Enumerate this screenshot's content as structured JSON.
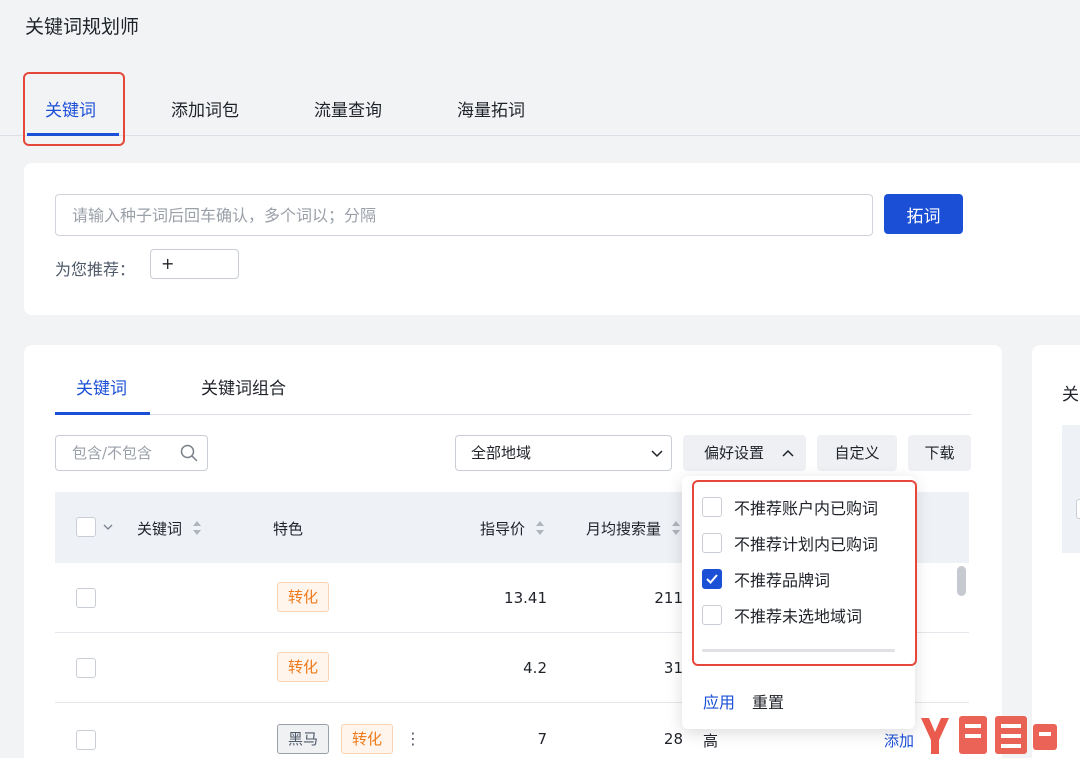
{
  "page": {
    "title": "关键词规划师"
  },
  "main_tabs": [
    "关键词",
    "添加词包",
    "流量查询",
    "海量拓词"
  ],
  "search": {
    "placeholder": "请输入种子词后回车确认，多个词以；分隔",
    "button_label": "拓词",
    "recommend_label": "为您推荐：",
    "recommend_add": "+"
  },
  "results": {
    "sub_tabs": [
      "关键词",
      "关键词组合"
    ],
    "filter_placeholder": "包含/不包含",
    "region": "全部地域",
    "preference_label": "偏好设置",
    "custom_label": "自定义",
    "download_label": "下载",
    "columns": [
      "关键词",
      "特色",
      "指导价",
      "月均搜索量"
    ],
    "rows": [
      {
        "tags": [
          "转化"
        ],
        "price": "13.41",
        "volume": "211"
      },
      {
        "tags": [
          "转化"
        ],
        "price": "4.2",
        "volume": "31"
      },
      {
        "tags": [
          "黑马",
          "转化"
        ],
        "more": "⋮",
        "price": "7",
        "volume": "28",
        "competition": "高",
        "action": "添加"
      }
    ]
  },
  "preference_menu": {
    "options": [
      {
        "label": "不推荐账户内已购词",
        "checked": false
      },
      {
        "label": "不推荐计划内已购词",
        "checked": false
      },
      {
        "label": "不推荐品牌词",
        "checked": true
      },
      {
        "label": "不推荐未选地域词",
        "checked": false
      }
    ],
    "apply_label": "应用",
    "reset_label": "重置"
  },
  "side_panel": {
    "title_partial": "关"
  },
  "colors": {
    "primary": "#1a4fd6",
    "highlight": "#e5483b",
    "tag_orange": "#ee7a1b"
  }
}
